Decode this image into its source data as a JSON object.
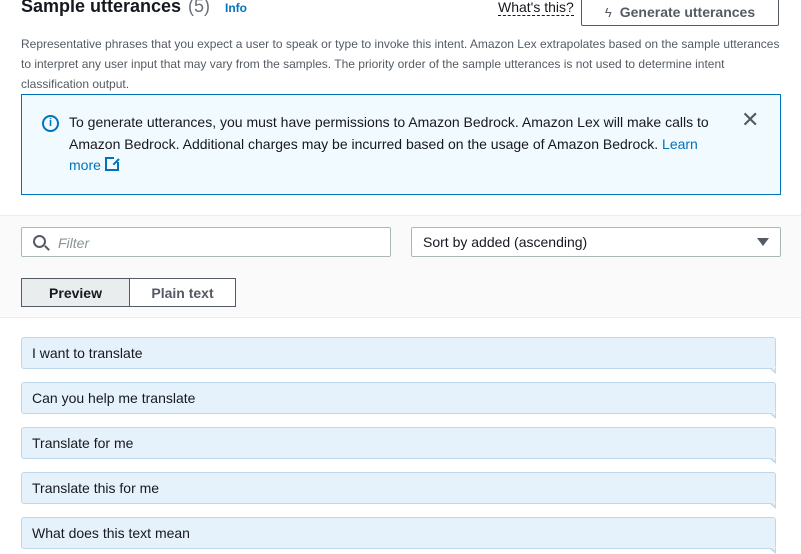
{
  "header": {
    "title": "Sample utterances",
    "count": "(5)",
    "info_label": "Info",
    "whats_this": "What's this?",
    "generate_label": "Generate utterances"
  },
  "description": "Representative phrases that you expect a user to speak or type to invoke this intent. Amazon Lex extrapolates based on the sample utterances to interpret any user input that may vary from the samples. The priority order of the sample utterances is not used to determine intent classification output.",
  "alert": {
    "message": "To generate utterances, you must have permissions to Amazon Bedrock. Amazon Lex will make calls to Amazon Bedrock. Additional charges may be incurred based on the usage of Amazon Bedrock.",
    "link_label": "Learn more"
  },
  "filter": {
    "placeholder": "Filter"
  },
  "sort": {
    "selected": "Sort by added (ascending)"
  },
  "view_toggle": {
    "preview": "Preview",
    "plain": "Plain text",
    "active": "preview"
  },
  "utterances": [
    "I want to translate",
    "Can you help me translate",
    "Translate for me",
    "Translate this for me",
    "What does this text mean"
  ],
  "colors": {
    "accent": "#0073bb",
    "bubble": "#e6f2fb",
    "alert_bg": "#f1faff"
  }
}
